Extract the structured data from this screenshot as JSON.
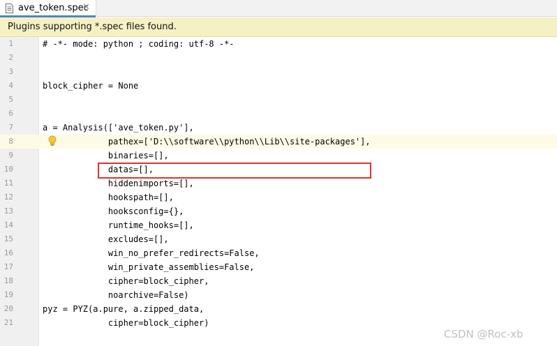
{
  "tab": {
    "label": "ave_token.spec",
    "close": "✕",
    "icon": "file-icon"
  },
  "banner": {
    "text": "Plugins supporting *.spec files found."
  },
  "editor": {
    "caret_line": 8,
    "lines": [
      {
        "no": "1",
        "text": "# -*- mode: python ; coding: utf-8 -*-"
      },
      {
        "no": "2",
        "text": ""
      },
      {
        "no": "3",
        "text": ""
      },
      {
        "no": "4",
        "text": "block_cipher = None"
      },
      {
        "no": "5",
        "text": ""
      },
      {
        "no": "6",
        "text": ""
      },
      {
        "no": "7",
        "text": "a = Analysis(['ave_token.py'],"
      },
      {
        "no": "8",
        "text": "             pathex=['D:\\\\software\\\\python\\\\Lib\\\\site-packages'],"
      },
      {
        "no": "9",
        "text": "             binaries=[],"
      },
      {
        "no": "10",
        "text": "             datas=[],"
      },
      {
        "no": "11",
        "text": "             hiddenimports=[],"
      },
      {
        "no": "12",
        "text": "             hookspath=[],"
      },
      {
        "no": "13",
        "text": "             hooksconfig={},"
      },
      {
        "no": "14",
        "text": "             runtime_hooks=[],"
      },
      {
        "no": "15",
        "text": "             excludes=[],"
      },
      {
        "no": "16",
        "text": "             win_no_prefer_redirects=False,"
      },
      {
        "no": "17",
        "text": "             win_private_assemblies=False,"
      },
      {
        "no": "18",
        "text": "             cipher=block_cipher,"
      },
      {
        "no": "19",
        "text": "             noarchive=False)"
      },
      {
        "no": "20",
        "text": "pyz = PYZ(a.pure, a.zipped_data,"
      },
      {
        "no": "21",
        "text": "             cipher=block_cipher)"
      }
    ]
  },
  "annotation": {
    "color": "#e2302d",
    "marked_line": 10
  },
  "watermark": {
    "text": "CSDN @Roc-xb"
  }
}
